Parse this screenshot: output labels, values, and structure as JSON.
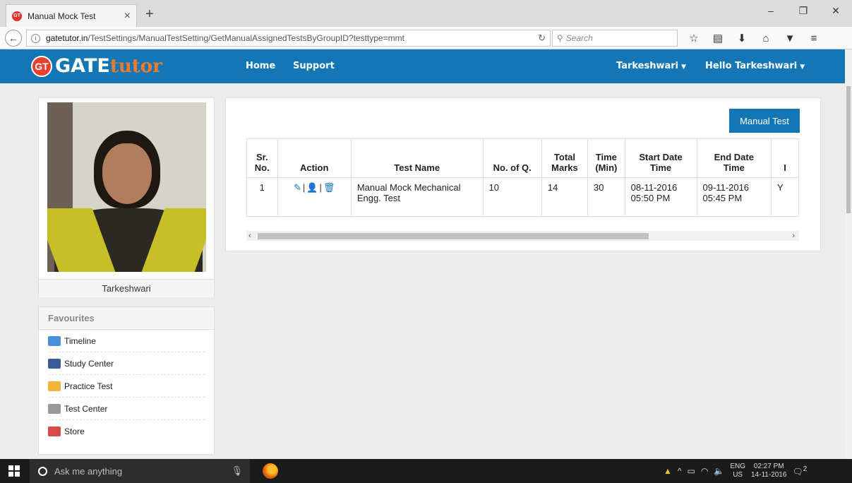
{
  "browser": {
    "tab_title": "Manual Mock Test",
    "tab_close": "×",
    "new_tab": "+",
    "url_host": "gatetutor.in",
    "url_path": "/TestSettings/ManualTestSetting/GetManualAssignedTestsByGroupID?testtype=mmt",
    "search_placeholder": "Search",
    "window_controls": [
      "–",
      "❐",
      "✕"
    ]
  },
  "site": {
    "logo_badge": "GT",
    "logo_main": "GATE",
    "logo_accent": "tutor",
    "nav_home": "Home",
    "nav_support": "Support",
    "nav_user_menu": "Tarkeshwari",
    "nav_hello_menu": "Hello Tarkeshwari"
  },
  "profile": {
    "name": "Tarkeshwari"
  },
  "favourites": {
    "heading": "Favourites",
    "items": [
      {
        "label": "Timeline",
        "icon": "timeline-icon",
        "color": "#4a90d9"
      },
      {
        "label": "Study Center",
        "icon": "books-icon",
        "color": "#3d5a99"
      },
      {
        "label": "Practice Test",
        "icon": "clipboard-icon",
        "color": "#f0b43c"
      },
      {
        "label": "Test Center",
        "icon": "test-center-icon",
        "color": "#999999"
      },
      {
        "label": "Store",
        "icon": "store-icon",
        "color": "#d94b4b"
      }
    ]
  },
  "main": {
    "manual_test_button": "Manual Test",
    "columns": [
      "Sr. No.",
      "Action",
      "Test Name",
      "No. of Q.",
      "Total Marks",
      "Time (Min)",
      "Start Date Time",
      "End Date Time",
      "I"
    ],
    "rows": [
      {
        "sr_no": "1",
        "test_name": "Manual Mock Mechanical Engg. Test",
        "no_of_q": "10",
        "total_marks": "14",
        "time_min": "30",
        "start": "08-11-2016 05:50 PM",
        "end": "09-11-2016 05:45 PM",
        "extra": "Y"
      }
    ]
  },
  "taskbar": {
    "search_placeholder": "Ask me anything",
    "lang_top": "ENG",
    "lang_bottom": "US",
    "time": "02:27 PM",
    "date": "14-11-2016",
    "notification_count": "2"
  },
  "colors": {
    "header_blue": "#1376b5",
    "logo_orange": "#f47a2c",
    "logo_red": "#e8402d"
  }
}
